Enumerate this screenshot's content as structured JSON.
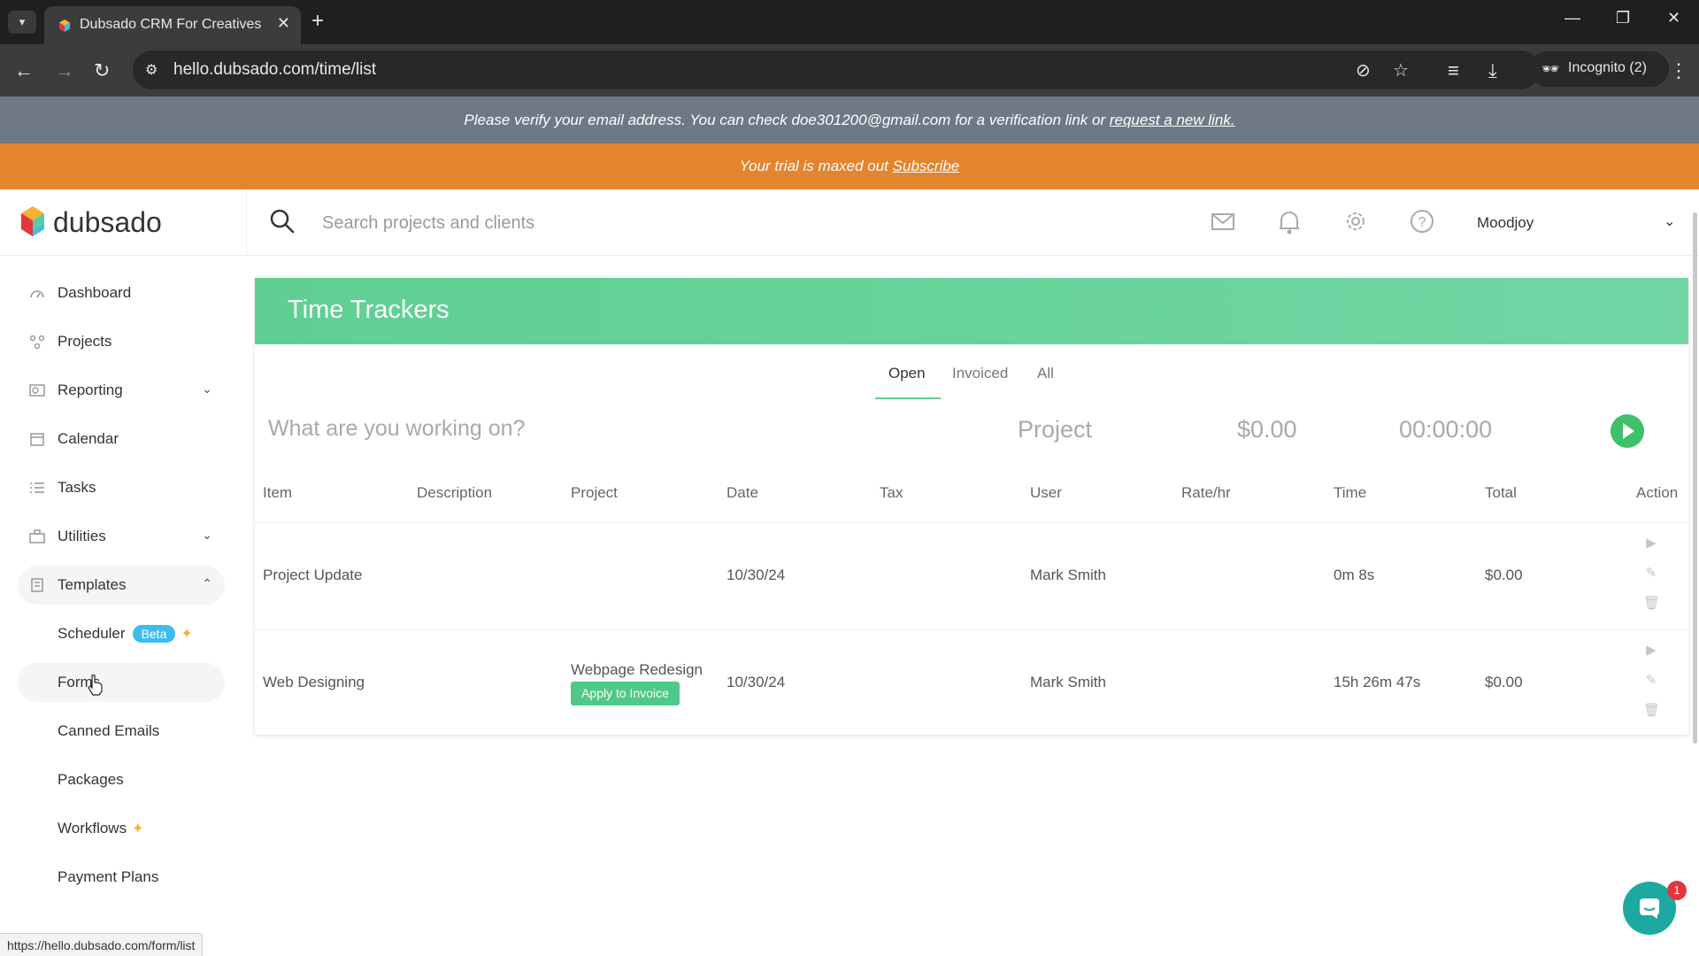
{
  "browser": {
    "tab_title": "Dubsado CRM For Creatives",
    "url": "hello.dubsado.com/time/list",
    "incognito_label": "Incognito (2)"
  },
  "banners": {
    "verify_text": "Please verify your email address. You can check doe301200@gmail.com for a verification link or",
    "verify_link": "request a new link.",
    "trial_text": "Your trial is maxed out",
    "trial_link": "Subscribe"
  },
  "app": {
    "logo_text": "dubsado",
    "search_placeholder": "Search projects and clients",
    "user_name": "Moodjoy"
  },
  "sidebar": {
    "items": [
      {
        "label": "Dashboard",
        "icon": "dashboard-icon"
      },
      {
        "label": "Projects",
        "icon": "projects-icon"
      },
      {
        "label": "Reporting",
        "icon": "reporting-icon"
      },
      {
        "label": "Calendar",
        "icon": "calendar-icon"
      },
      {
        "label": "Tasks",
        "icon": "tasks-icon"
      },
      {
        "label": "Utilities",
        "icon": "utilities-icon"
      },
      {
        "label": "Templates",
        "icon": "templates-icon"
      }
    ],
    "subitems": [
      {
        "label": "Scheduler",
        "badge": "Beta"
      },
      {
        "label": "Forms"
      },
      {
        "label": "Canned Emails"
      },
      {
        "label": "Packages"
      },
      {
        "label": "Workflows"
      },
      {
        "label": "Payment Plans"
      }
    ]
  },
  "main": {
    "title": "Time Trackers",
    "filters": [
      "Open",
      "Invoiced",
      "All"
    ],
    "active_filter": "Open",
    "tracker": {
      "placeholder": "What are you working on?",
      "project": "Project",
      "amount": "$0.00",
      "time": "00:00:00"
    },
    "columns": [
      "Item",
      "Description",
      "Project",
      "Date",
      "Tax",
      "User",
      "Rate/hr",
      "Time",
      "Total",
      "Action"
    ],
    "rows": [
      {
        "item": "Project Update",
        "description": "",
        "project": "",
        "date": "10/30/24",
        "tax": "",
        "user": "Mark Smith",
        "rate": "",
        "time": "0m 8s",
        "total": "$0.00"
      },
      {
        "item": "Web Designing",
        "description": "",
        "project": "Webpage Redesign",
        "apply_label": "Apply to Invoice",
        "date": "10/30/24",
        "tax": "",
        "user": "Mark Smith",
        "rate": "",
        "time": "15h 26m 47s",
        "total": "$0.00"
      }
    ]
  },
  "status_url": "https://hello.dubsado.com/form/list",
  "chat_badge": "1",
  "colors": {
    "header_green": "#5fcf93",
    "trial_orange": "#e3842e",
    "verify_gray": "#6f7885",
    "beta_blue": "#3dbcf0",
    "play_green": "#3fc16b"
  }
}
